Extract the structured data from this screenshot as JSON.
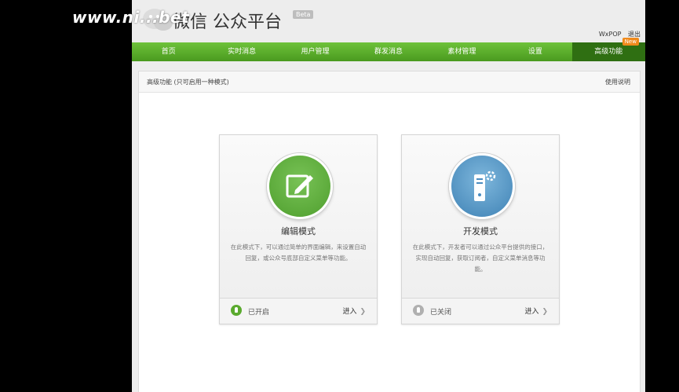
{
  "watermark": "www.ni...bet",
  "header": {
    "title": "微信 公众平台",
    "beta": "Beta",
    "username": "WxPOP",
    "logout": "退出"
  },
  "nav": {
    "items": [
      {
        "label": "首页"
      },
      {
        "label": "实时消息"
      },
      {
        "label": "用户管理"
      },
      {
        "label": "群发消息"
      },
      {
        "label": "素材管理"
      },
      {
        "label": "设置"
      },
      {
        "label": "高级功能",
        "badge": "New"
      }
    ]
  },
  "content": {
    "title": "高级功能 (只可启用一种模式)",
    "help": "使用说明"
  },
  "cards": {
    "edit": {
      "title": "编辑模式",
      "desc": "在此模式下，可以通过简单的界面编辑，来设置自动回复，或公众号底部自定义菜单等功能。",
      "status": "已开启",
      "enter": "进入",
      "icon": "pencil-icon"
    },
    "dev": {
      "title": "开发模式",
      "desc": "在此模式下，开发者可以通过公众平台提供的接口，实现自动回复，获取订阅者，自定义菜单消息等功能。",
      "status": "已关闭",
      "enter": "进入",
      "icon": "server-gear-icon"
    }
  },
  "colors": {
    "nav_green": "#5cb02c",
    "nav_active": "#2f6f12",
    "badge_orange": "#f08a1c",
    "edit_green": "#5aaa2e",
    "dev_blue": "#4a8cc0"
  }
}
